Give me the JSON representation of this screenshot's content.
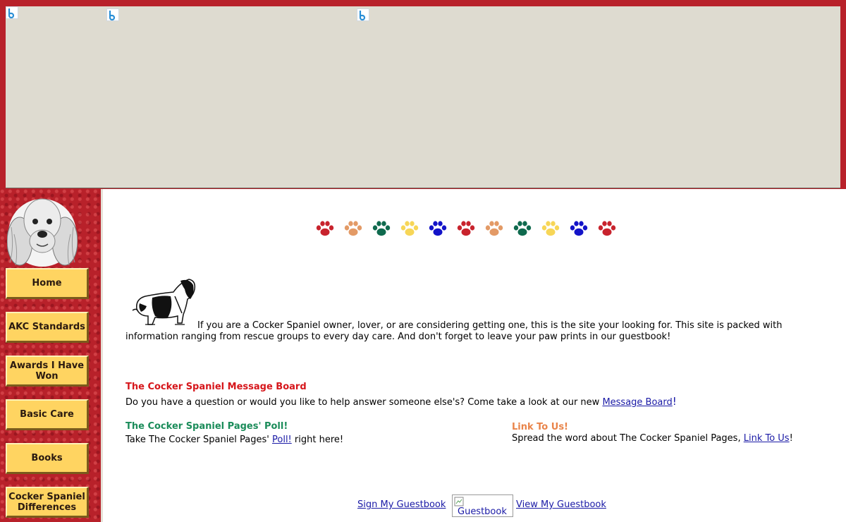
{
  "nav": {
    "items": [
      {
        "label": "Home"
      },
      {
        "label": "AKC Standards"
      },
      {
        "label": "Awards I Have Won"
      },
      {
        "label": "Basic Care"
      },
      {
        "label": "Books"
      },
      {
        "label": "Cocker Spaniel Differences"
      }
    ]
  },
  "paws": {
    "colors": [
      "#c8232d",
      "#e39a66",
      "#0f6a4e",
      "#f7d657",
      "#1313c8",
      "#c8232d",
      "#e39a66",
      "#0f6a4e",
      "#f7d657",
      "#1313c8",
      "#c8232d"
    ]
  },
  "intro": {
    "text": "If you are a Cocker Spaniel owner, lover, or are considering getting one, this is the site your looking for.  This site is packed with information ranging from rescue groups to every day care.  And don't forget to leave your paw prints in our guestbook!"
  },
  "message_board": {
    "heading": "The Cocker Spaniel Message Board",
    "text": "Do you have a question or would you like to help answer someone else's?  Come take a look at our new ",
    "link": "Message Board",
    "suffix": "!"
  },
  "poll": {
    "heading": "The Cocker Spaniel Pages' Poll!",
    "text_before": "Take The Cocker Spaniel Pages' ",
    "link": "Poll!",
    "text_after": " right here!"
  },
  "link_to_us": {
    "heading": "Link To Us!",
    "text": "Spread the word about The Cocker Spaniel Pages, ",
    "link": "Link To Us",
    "suffix": "!"
  },
  "guestbook": {
    "sign": "Sign My Guestbook",
    "image_alt": "Guestbook",
    "view": "View My Guestbook"
  },
  "colors": {
    "frame_red": "#b8212a",
    "banner_bg": "#dedbd0",
    "button_yellow": "#ffd461",
    "heading_red": "#d6161b",
    "heading_green": "#1b8c5a",
    "heading_orange": "#e9844a",
    "link_blue": "#1a1aa6"
  }
}
